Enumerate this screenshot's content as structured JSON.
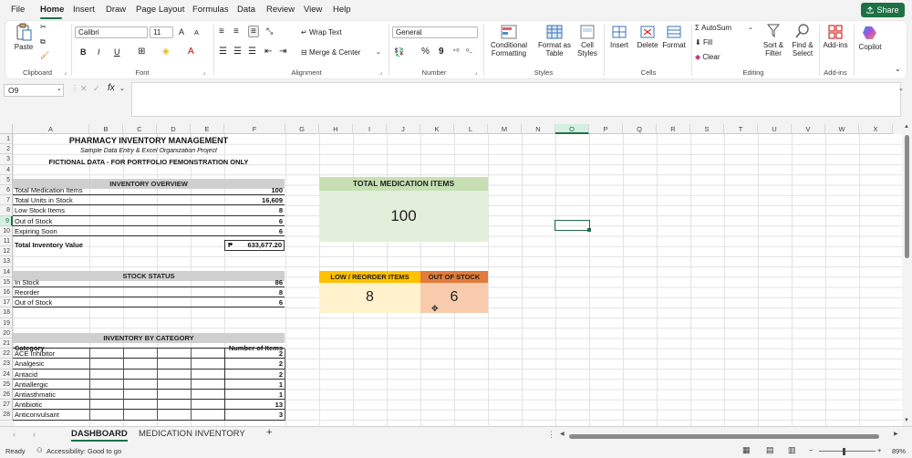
{
  "menu": [
    "File",
    "Home",
    "Insert",
    "Draw",
    "Page Layout",
    "Formulas",
    "Data",
    "Review",
    "View",
    "Help"
  ],
  "share_label": "Share",
  "ribbon": {
    "clipboard": {
      "paste": "Paste",
      "label": "Clipboard"
    },
    "font": {
      "name": "Calibri",
      "size": "11",
      "label": "Font",
      "bold": "B",
      "italic": "I",
      "underline": "U",
      "grow": "A",
      "shrink": "A"
    },
    "alignment": {
      "wrap": "Wrap Text",
      "merge": "Merge & Center",
      "label": "Alignment"
    },
    "number": {
      "format": "General",
      "label": "Number",
      "percent": "%",
      "comma": "9"
    },
    "styles": {
      "conditional": "Conditional Formatting",
      "format_table": "Format as Table",
      "cell_styles": "Cell Styles",
      "label": "Styles"
    },
    "cells": {
      "insert": "Insert",
      "delete": "Delete",
      "format": "Format",
      "label": "Cells"
    },
    "editing": {
      "autosum": "AutoSum",
      "fill": "Fill",
      "clear": "Clear",
      "sort": "Sort & Filter",
      "find": "Find & Select",
      "label": "Editing"
    },
    "addins": {
      "addins": "Add-ins",
      "label": "Add-ins"
    },
    "copilot": "Copilot"
  },
  "formula_bar": {
    "cell_ref": "O9",
    "fx": "fx",
    "value": ""
  },
  "columns": [
    "A",
    "B",
    "C",
    "D",
    "E",
    "F",
    "G",
    "H",
    "I",
    "J",
    "K",
    "L",
    "M",
    "N",
    "O",
    "P",
    "Q",
    "R",
    "S",
    "T",
    "U",
    "V",
    "W",
    "X"
  ],
  "rows": [
    "1",
    "2",
    "3",
    "4",
    "5",
    "6",
    "7",
    "8",
    "9",
    "10",
    "11",
    "12",
    "13",
    "14",
    "15",
    "16",
    "17",
    "18",
    "19",
    "20",
    "21",
    "22",
    "23",
    "24",
    "25",
    "26",
    "27",
    "28"
  ],
  "sheet": {
    "title": "PHARMACY INVENTORY MANAGEMENT",
    "subtitle": "Sample Data Entry & Excel Organization Project",
    "note": "FICTIONAL DATA - FOR PORTFOLIO FEMONSTRATION ONLY",
    "overview": {
      "header": "INVENTORY OVERVIEW",
      "rows": [
        {
          "label": "Total Medication Items",
          "value": "100"
        },
        {
          "label": "Total Units in Stock",
          "value": "16,609"
        },
        {
          "label": "Low Stock Items",
          "value": "8"
        },
        {
          "label": "Out of Stock",
          "value": "6"
        },
        {
          "label": "Expiring Soon",
          "value": "6"
        }
      ],
      "total_label": "Total Inventory Value",
      "total_currency": "₱",
      "total_value": "633,677.20"
    },
    "stock_status": {
      "header": "STOCK STATUS",
      "rows": [
        {
          "label": "In Stock",
          "value": "86"
        },
        {
          "label": "Reorder",
          "value": "8"
        },
        {
          "label": "Out of Stock",
          "value": "6"
        }
      ]
    },
    "by_category": {
      "header": "INVENTORY BY CATEGORY",
      "col_category": "Category",
      "col_count": "Number of Items",
      "rows": [
        {
          "label": "ACE Inhibitor",
          "value": "2"
        },
        {
          "label": "Analgesic",
          "value": "2"
        },
        {
          "label": "Antacid",
          "value": "2"
        },
        {
          "label": "Antiallergic",
          "value": "1"
        },
        {
          "label": "Antiasthmatic",
          "value": "1"
        },
        {
          "label": "Antibiotic",
          "value": "13"
        },
        {
          "label": "Anticonvulsant",
          "value": "3"
        }
      ]
    }
  },
  "cards": {
    "total": {
      "title": "TOTAL MEDICATION ITEMS",
      "value": "100",
      "header_color": "#c6e0b4",
      "body_color": "#e2efda"
    },
    "low": {
      "title": "LOW / REORDER ITEMS",
      "value": "8",
      "header_color": "#ffc000",
      "body_color": "#fff2cc"
    },
    "out": {
      "title": "OUT OF STOCK",
      "value": "6",
      "header_color": "#e07b39",
      "body_color": "#f8cbad"
    }
  },
  "tabs": [
    "DASHBOARD",
    "MEDICATION INVENTORY"
  ],
  "add_sheet": "+",
  "status": {
    "ready": "Ready",
    "accessibility": "Accessibility: Good to go",
    "zoom": "89%"
  }
}
